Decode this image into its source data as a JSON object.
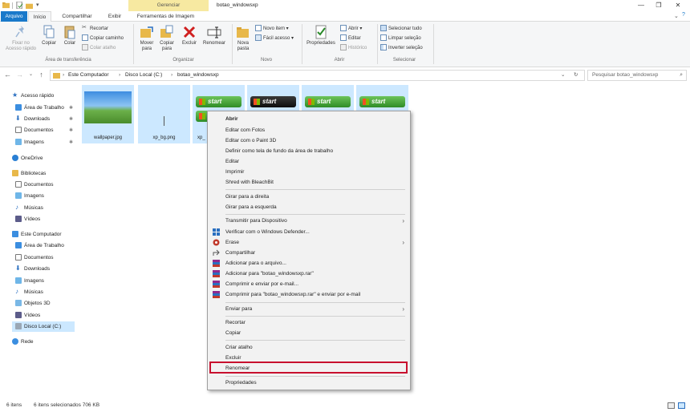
{
  "window": {
    "context_tab_group": "Gerenciar",
    "title": "botao_windowsxp"
  },
  "tabs": [
    "Arquivo",
    "Início",
    "Compartilhar",
    "Exibir",
    "Ferramentas de Imagem"
  ],
  "ribbon": {
    "clipboard": {
      "pin": "Fixar no Acesso rápido",
      "copy": "Copiar",
      "paste": "Colar",
      "cut": "Recortar",
      "copy_path": "Copiar caminho",
      "paste_shortcut": "Colar atalho",
      "label": "Área de transferência"
    },
    "organize": {
      "move": "Mover para",
      "copy_to": "Copiar para",
      "delete": "Excluir",
      "rename": "Renomear",
      "label": "Organizar"
    },
    "new": {
      "new_folder": "Nova pasta",
      "new_item": "Novo item",
      "easy_access": "Fácil acesso",
      "label": "Novo"
    },
    "open": {
      "properties": "Propriedades",
      "open": "Abrir",
      "edit": "Editar",
      "history": "Histórico",
      "label": "Abrir"
    },
    "select": {
      "select_all": "Selecionar tudo",
      "select_none": "Limpar seleção",
      "invert": "Inverter seleção",
      "label": "Selecionar"
    }
  },
  "address": {
    "crumbs": [
      "Este Computador",
      "Disco Local (C:)",
      "botao_windowsxp"
    ],
    "search_placeholder": "Pesquisar botao_windowsxp"
  },
  "nav": {
    "quick_access": "Acesso rápido",
    "qa_items": [
      "Área de Trabalho",
      "Downloads",
      "Documentos",
      "Imagens"
    ],
    "onedrive": "OneDrive",
    "libraries": "Bibliotecas",
    "lib_items": [
      "Documentos",
      "Imagens",
      "Músicas",
      "Vídeos"
    ],
    "this_pc": "Este Computador",
    "pc_items": [
      "Área de Trabalho",
      "Documentos",
      "Downloads",
      "Imagens",
      "Músicas",
      "Objetos 3D",
      "Vídeos",
      "Disco Local (C:)"
    ],
    "network": "Rede"
  },
  "files": [
    {
      "name": "wallpaper.jpg"
    },
    {
      "name": "xp_bg.png"
    },
    {
      "name": "xp_"
    },
    {
      "name": ""
    },
    {
      "name": ""
    },
    {
      "name": ""
    }
  ],
  "thumb_text": {
    "start": "start"
  },
  "context_menu": {
    "open": "Abrir",
    "edit_photos": "Editar com Fotos",
    "edit_paint3d": "Editar com o Paint 3D",
    "set_background": "Definir como tela de fundo da área de trabalho",
    "edit": "Editar",
    "print": "Imprimir",
    "shred": "Shred with BleachBit",
    "rotate_right": "Girar para a direita",
    "rotate_left": "Girar para a esquerda",
    "cast": "Transmitir para Dispositivo",
    "defender": "Verificar com o Windows Defender...",
    "erase": "Erase",
    "share": "Compartilhar",
    "add_archive": "Adicionar para o arquivo...",
    "add_rar": "Adicionar para \"botao_windowsxp.rar\"",
    "compress_email": "Comprimir e enviar por e-mail...",
    "compress_rar_email": "Comprimir para \"botao_windowsxp.rar\" e enviar por e-mail",
    "send_to": "Enviar para",
    "cut": "Recortar",
    "copy": "Copiar",
    "create_shortcut": "Criar atalho",
    "delete": "Excluir",
    "rename": "Renomear",
    "properties": "Propriedades"
  },
  "status": {
    "item_count": "6 itens",
    "selection": "6 itens selecionados  706 KB"
  },
  "colors": {
    "accent": "#1979ca",
    "selection": "#cce8ff",
    "highlight_box": "#c8102e"
  }
}
